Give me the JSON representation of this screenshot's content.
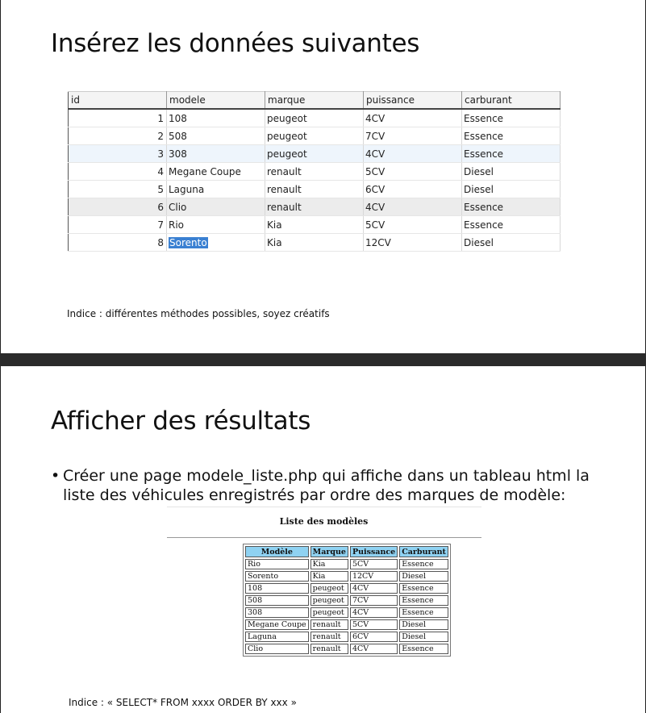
{
  "slide1": {
    "title": "Insérez les données suivantes",
    "table": {
      "columns": [
        "id",
        "modele",
        "marque",
        "puissance",
        "carburant"
      ],
      "rows": [
        [
          "1",
          "108",
          "peugeot",
          "4CV",
          "Essence"
        ],
        [
          "2",
          "508",
          "peugeot",
          "7CV",
          "Essence"
        ],
        [
          "3",
          "308",
          "peugeot",
          "4CV",
          "Essence"
        ],
        [
          "4",
          "Megane Coupe",
          "renault",
          "5CV",
          "Diesel"
        ],
        [
          "5",
          "Laguna",
          "renault",
          "6CV",
          "Diesel"
        ],
        [
          "6",
          "Clio",
          "renault",
          "4CV",
          "Essence"
        ],
        [
          "7",
          "Rio",
          "Kia",
          "5CV",
          "Essence"
        ],
        [
          "8",
          "Sorento",
          "Kia",
          "12CV",
          "Diesel"
        ]
      ]
    },
    "hint": "Indice : différentes méthodes possibles, soyez créatifs"
  },
  "slide2": {
    "title": "Afficher des résultats",
    "bullet_symbol": "•",
    "bullet": "Créer une page modele_liste.php qui affiche dans un tableau html la liste des véhicules enregistrés par ordre des marques de modèle:",
    "preview": {
      "title": "Liste des modèles",
      "columns": [
        "Modèle",
        "Marque",
        "Puissance",
        "Carburant"
      ],
      "rows": [
        [
          "Rio",
          "Kia",
          "5CV",
          "Essence"
        ],
        [
          "Sorento",
          "Kia",
          "12CV",
          "Diesel"
        ],
        [
          "108",
          "peugeot",
          "4CV",
          "Essence"
        ],
        [
          "508",
          "peugeot",
          "7CV",
          "Essence"
        ],
        [
          "308",
          "peugeot",
          "4CV",
          "Essence"
        ],
        [
          "Megane Coupe",
          "renault",
          "5CV",
          "Diesel"
        ],
        [
          "Laguna",
          "renault",
          "6CV",
          "Diesel"
        ],
        [
          "Clio",
          "renault",
          "4CV",
          "Essence"
        ]
      ]
    },
    "hint": "Indice : « SELECT* FROM xxxx ORDER BY xxx »"
  }
}
